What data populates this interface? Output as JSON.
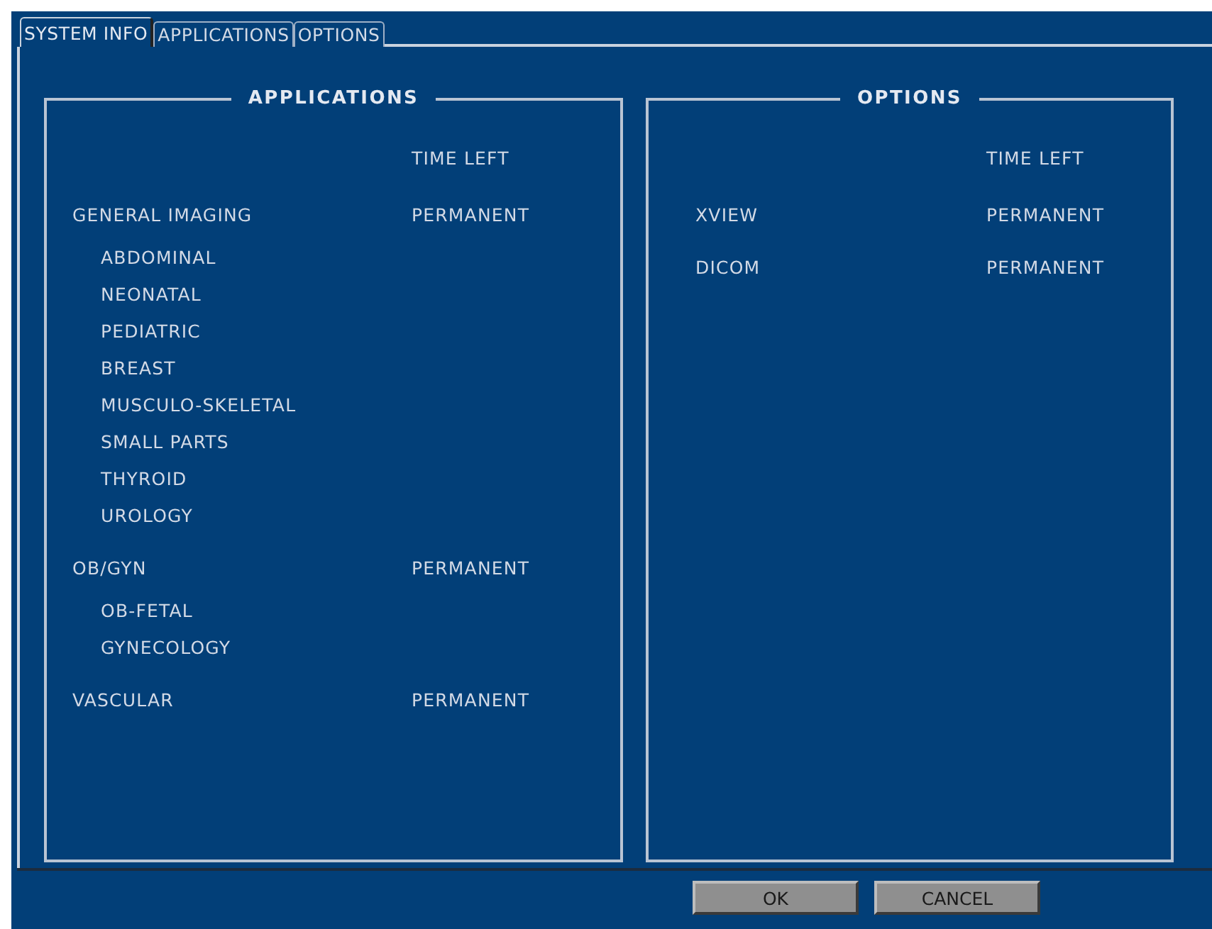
{
  "tabs": [
    {
      "label": "SYSTEM INFO",
      "selected": true
    },
    {
      "label": "APPLICATIONS",
      "selected": false
    },
    {
      "label": "OPTIONS",
      "selected": false
    }
  ],
  "applications": {
    "title": "APPLICATIONS",
    "column_header": "TIME LEFT",
    "items": [
      {
        "name": "GENERAL IMAGING",
        "time_left": "PERMANENT",
        "children": [
          {
            "name": "ABDOMINAL"
          },
          {
            "name": "NEONATAL"
          },
          {
            "name": "PEDIATRIC"
          },
          {
            "name": "BREAST"
          },
          {
            "name": "MUSCULO-SKELETAL"
          },
          {
            "name": "SMALL PARTS"
          },
          {
            "name": "THYROID"
          },
          {
            "name": "UROLOGY"
          }
        ]
      },
      {
        "name": "OB/GYN",
        "time_left": "PERMANENT",
        "children": [
          {
            "name": "OB-FETAL"
          },
          {
            "name": "GYNECOLOGY"
          }
        ]
      },
      {
        "name": "VASCULAR",
        "time_left": "PERMANENT"
      }
    ]
  },
  "options": {
    "title": "OPTIONS",
    "column_header": "TIME LEFT",
    "items": [
      {
        "name": "XVIEW",
        "time_left": "PERMANENT"
      },
      {
        "name": "DICOM",
        "time_left": "PERMANENT"
      }
    ]
  },
  "buttons": [
    "OK",
    "CANCEL"
  ]
}
